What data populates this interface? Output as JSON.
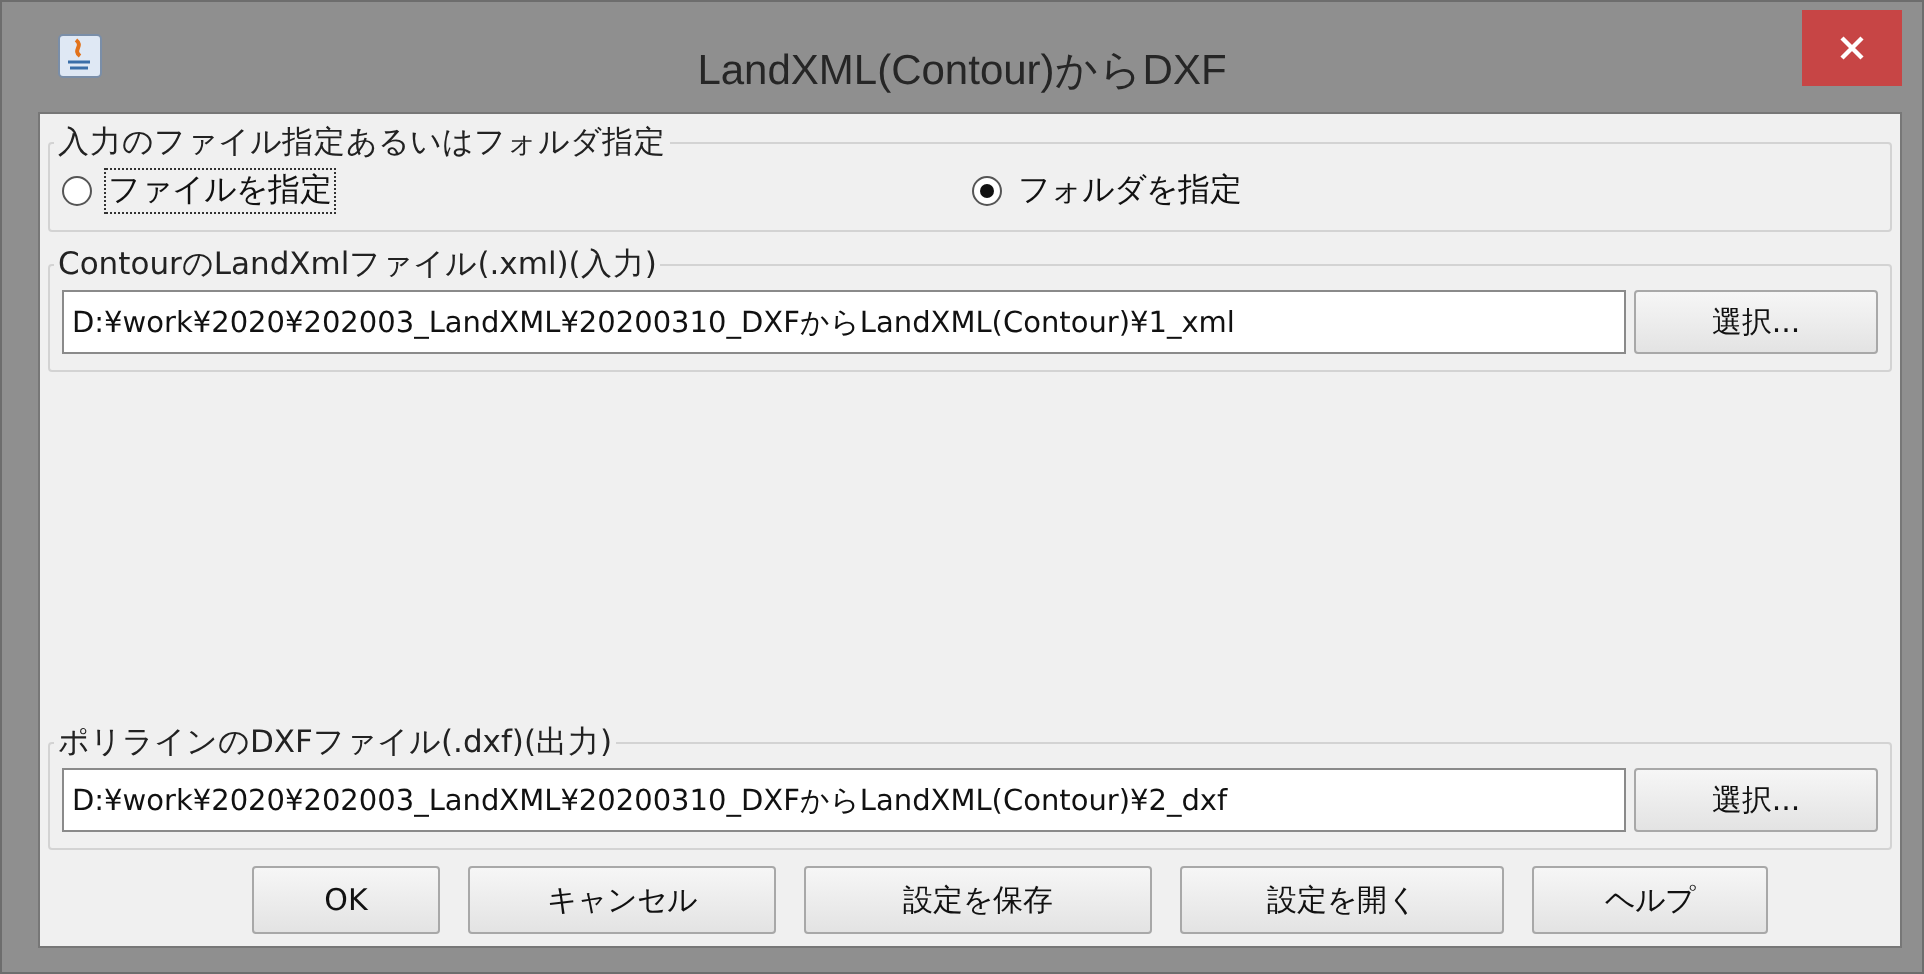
{
  "window": {
    "title": "LandXML(Contour)からDXF"
  },
  "input_mode": {
    "legend": "入力のファイル指定あるいはフォルダ指定",
    "options": [
      {
        "label": "ファイルを指定",
        "selected": false,
        "focused": true
      },
      {
        "label": "フォルダを指定",
        "selected": true,
        "focused": false
      }
    ]
  },
  "file_groups": [
    {
      "legend": "ContourのLandXmlファイル(.xml)(入力)",
      "value": "D:¥work¥2020¥202003_LandXML¥20200310_DXFからLandXML(Contour)¥1_xml",
      "button": "選択..."
    },
    {
      "legend": "ポリラインのDXFファイル(.dxf)(出力)",
      "value": "D:¥work¥2020¥202003_LandXML¥20200310_DXFからLandXML(Contour)¥2_dxf",
      "button": "選択..."
    }
  ],
  "buttons": [
    "OK",
    "キャンセル",
    "設定を保存",
    "設定を開く",
    "ヘルプ"
  ]
}
